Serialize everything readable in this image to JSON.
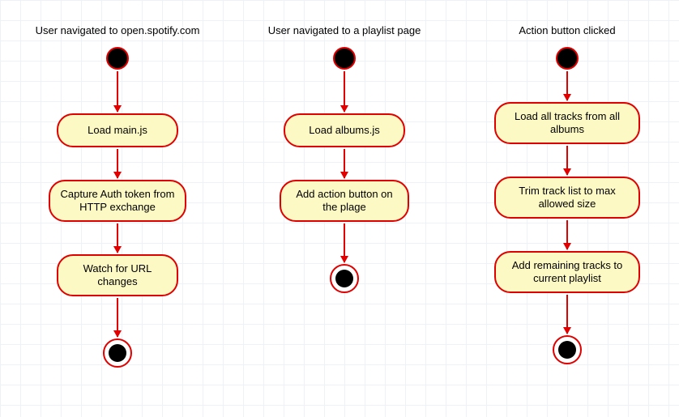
{
  "lanes": [
    {
      "title": "User navigated to open.spotify.com",
      "activities": [
        "Load main.js",
        "Capture Auth token from HTTP exchange",
        "Watch for URL changes"
      ]
    },
    {
      "title": "User navigated to a playlist page",
      "activities": [
        "Load albums.js",
        "Add action button on the plage"
      ]
    },
    {
      "title": "Action button clicked",
      "activities": [
        "Load all tracks from all albums",
        "Trim track list to max allowed size",
        "Add remaining tracks to current playlist"
      ]
    }
  ]
}
